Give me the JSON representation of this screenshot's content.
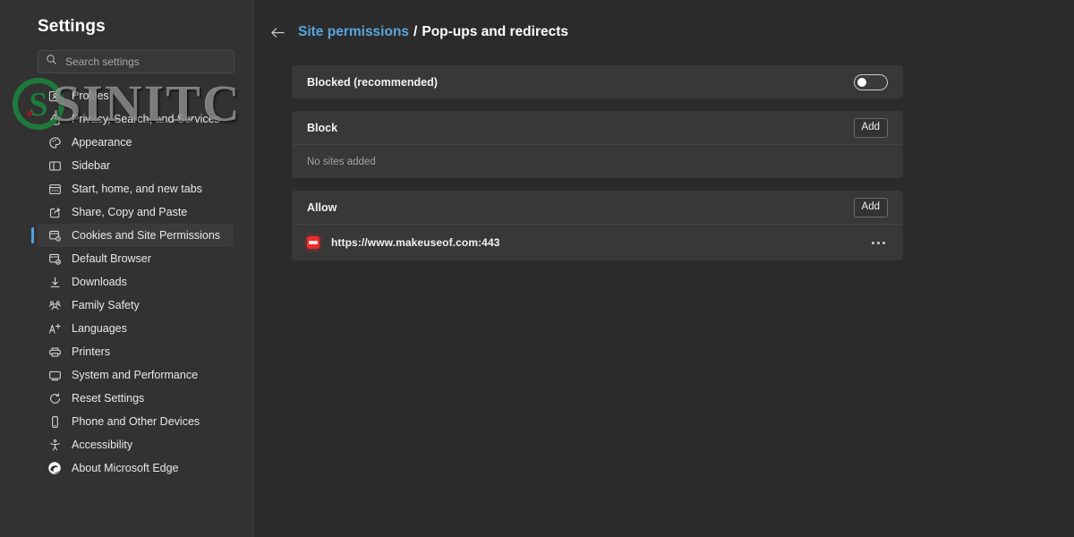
{
  "sidebar": {
    "title": "Settings",
    "search": {
      "placeholder": "Search settings",
      "value": "",
      "icon": "search-icon"
    },
    "items": [
      {
        "label": "Profiles",
        "icon": "profile-icon",
        "selected": false
      },
      {
        "label": "Privacy, Search, and Services",
        "icon": "lock-icon",
        "selected": false
      },
      {
        "label": "Appearance",
        "icon": "palette-icon",
        "selected": false
      },
      {
        "label": "Sidebar",
        "icon": "sidebar-icon",
        "selected": false
      },
      {
        "label": "Start, home, and new tabs",
        "icon": "home-tabs-icon",
        "selected": false
      },
      {
        "label": "Share, Copy and Paste",
        "icon": "share-icon",
        "selected": false
      },
      {
        "label": "Cookies and Site Permissions",
        "icon": "cookies-icon",
        "selected": true
      },
      {
        "label": "Default Browser",
        "icon": "default-browser-icon",
        "selected": false
      },
      {
        "label": "Downloads",
        "icon": "download-icon",
        "selected": false
      },
      {
        "label": "Family Safety",
        "icon": "family-icon",
        "selected": false
      },
      {
        "label": "Languages",
        "icon": "languages-icon",
        "selected": false
      },
      {
        "label": "Printers",
        "icon": "printer-icon",
        "selected": false
      },
      {
        "label": "System and Performance",
        "icon": "monitor-icon",
        "selected": false
      },
      {
        "label": "Reset Settings",
        "icon": "reset-icon",
        "selected": false
      },
      {
        "label": "Phone and Other Devices",
        "icon": "phone-icon",
        "selected": false
      },
      {
        "label": "Accessibility",
        "icon": "accessibility-icon",
        "selected": false
      },
      {
        "label": "About Microsoft Edge",
        "icon": "edge-logo-icon",
        "selected": false
      }
    ]
  },
  "watermark": {
    "text": "SINITC",
    "logo_letter": "S",
    "logo_color": "#1e7a3c"
  },
  "breadcrumb": {
    "back_icon": "back-arrow-icon",
    "parent": "Site permissions",
    "separator": "/",
    "current": "Pop-ups and redirects"
  },
  "main": {
    "blocked_card": {
      "label": "Blocked (recommended)",
      "toggle_state": "off"
    },
    "block_card": {
      "title": "Block",
      "add_label": "Add",
      "empty_text": "No sites added",
      "sites": []
    },
    "allow_card": {
      "title": "Allow",
      "add_label": "Add",
      "sites": [
        {
          "url": "https://www.makeuseof.com:443",
          "favicon": "makeuseof-favicon",
          "menu_icon": "more-options-icon"
        }
      ]
    }
  },
  "colors": {
    "accent": "#4fa3e3",
    "link": "#58a6dd",
    "sidebar_bg": "#323232",
    "main_bg": "#2b2b2b",
    "card_bg": "#383838",
    "favicon_red": "#ee2b2b"
  }
}
